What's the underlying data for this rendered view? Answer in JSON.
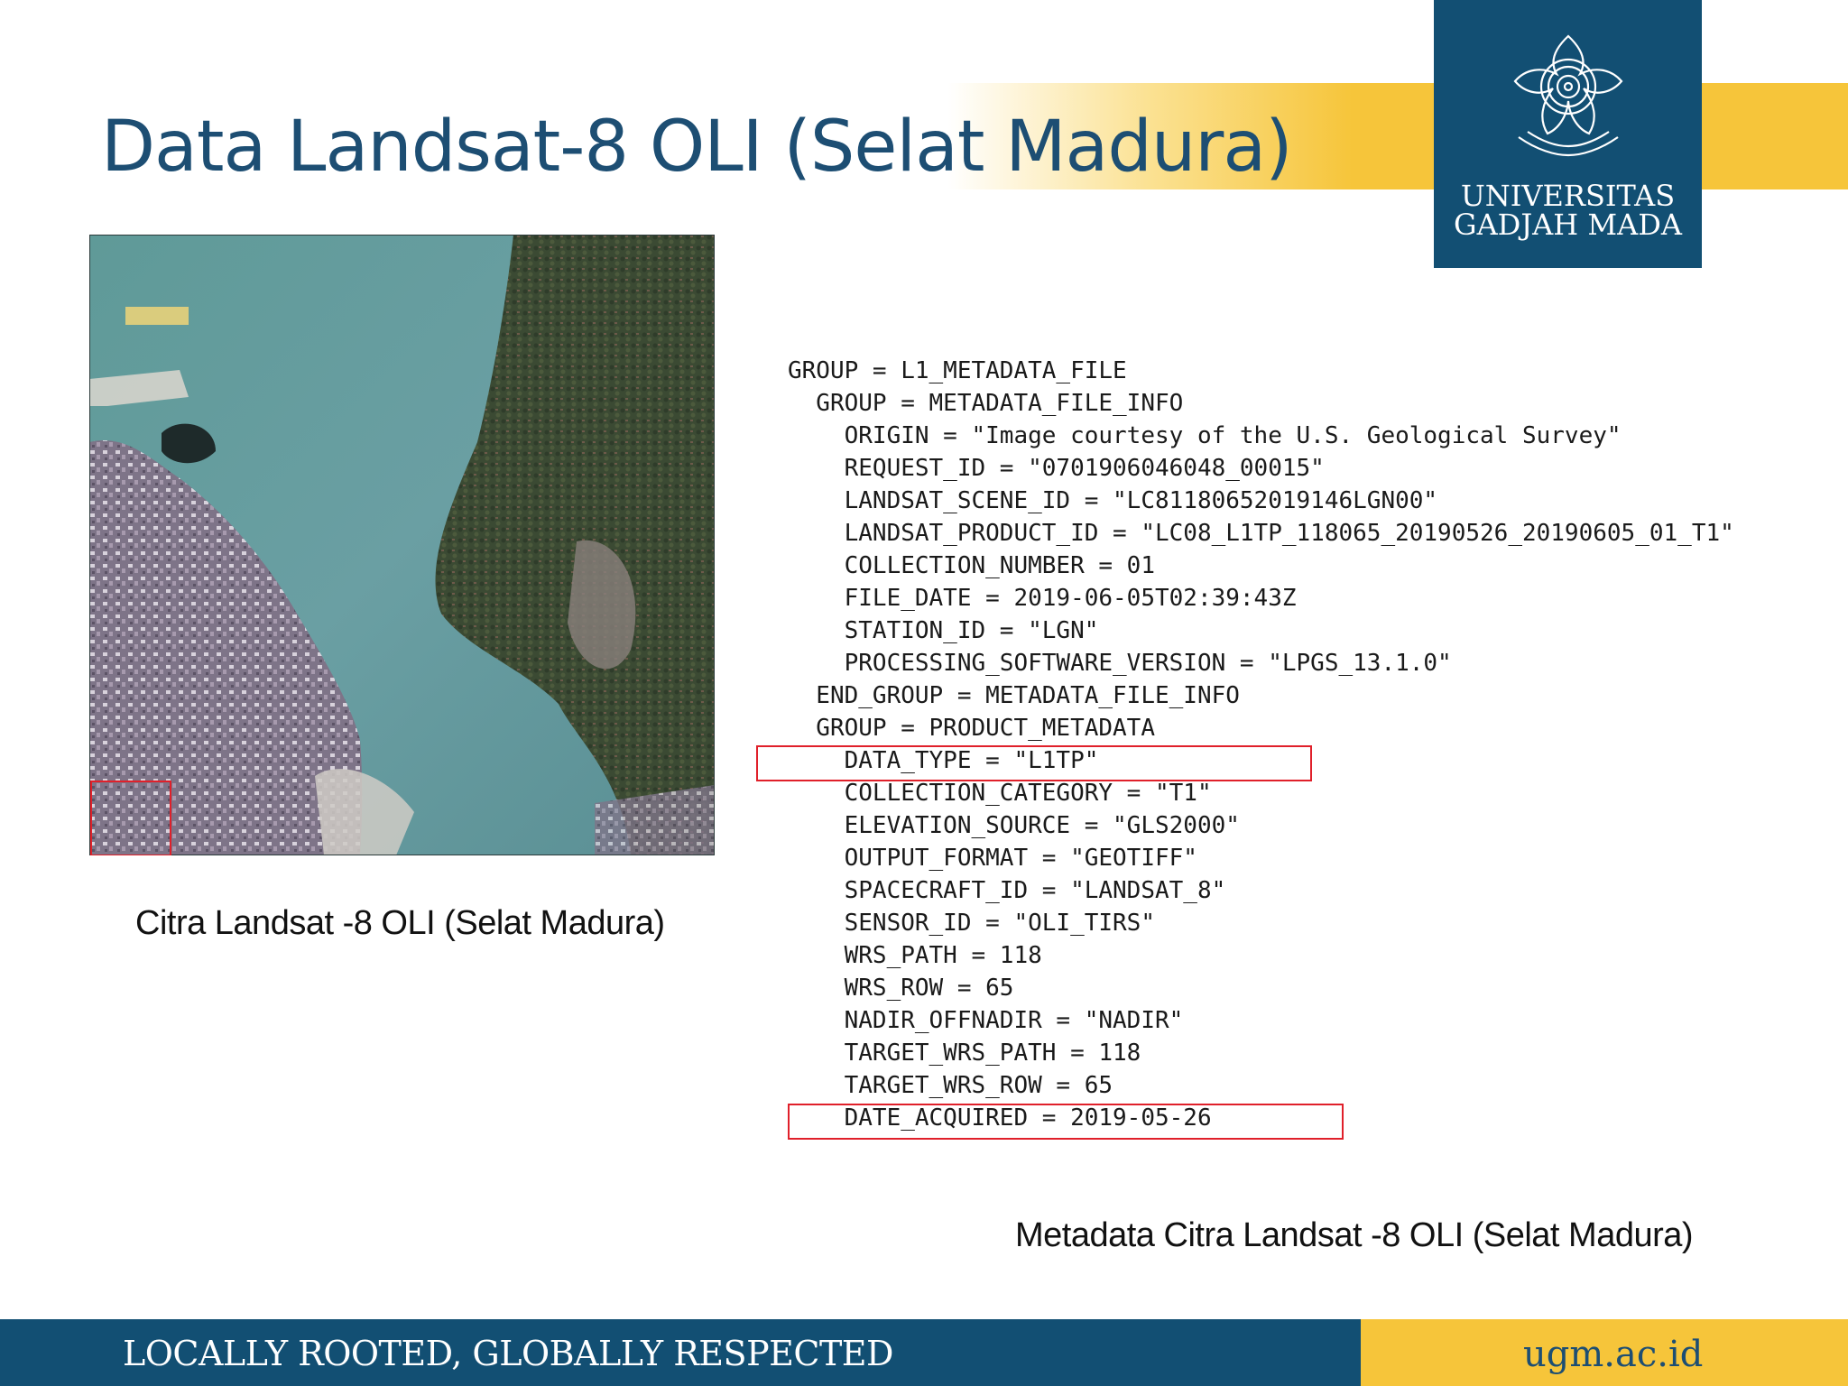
{
  "slide": {
    "title": "Data Landsat-8 OLI (Selat Madura)"
  },
  "logo": {
    "line1": "UNIVERSITAS",
    "line2": "GADJAH MADA",
    "emblem": "ugm-seal-icon"
  },
  "image": {
    "description_icon": "satellite-image",
    "caption": "Citra Landsat -8 OLI (Selat Madura)"
  },
  "metadata": {
    "lines": [
      "GROUP = L1_METADATA_FILE",
      "  GROUP = METADATA_FILE_INFO",
      "    ORIGIN = \"Image courtesy of the U.S. Geological Survey\"",
      "    REQUEST_ID = \"0701906046048_00015\"",
      "    LANDSAT_SCENE_ID = \"LC81180652019146LGN00\"",
      "    LANDSAT_PRODUCT_ID = \"LC08_L1TP_118065_20190526_20190605_01_T1\"",
      "    COLLECTION_NUMBER = 01",
      "    FILE_DATE = 2019-06-05T02:39:43Z",
      "    STATION_ID = \"LGN\"",
      "    PROCESSING_SOFTWARE_VERSION = \"LPGS_13.1.0\"",
      "  END_GROUP = METADATA_FILE_INFO",
      "  GROUP = PRODUCT_METADATA",
      "    DATA_TYPE = \"L1TP\"",
      "    COLLECTION_CATEGORY = \"T1\"",
      "    ELEVATION_SOURCE = \"GLS2000\"",
      "    OUTPUT_FORMAT = \"GEOTIFF\"",
      "    SPACECRAFT_ID = \"LANDSAT_8\"",
      "    SENSOR_ID = \"OLI_TIRS\"",
      "    WRS_PATH = 118",
      "    WRS_ROW = 65",
      "    NADIR_OFFNADIR = \"NADIR\"",
      "    TARGET_WRS_PATH = 118",
      "    TARGET_WRS_ROW = 65",
      "    DATE_ACQUIRED = 2019-05-26"
    ],
    "caption": "Metadata Citra Landsat -8 OLI (Selat Madura)",
    "highlight_color": "#e0202a"
  },
  "footer": {
    "motto": "LOCALLY ROOTED, GLOBALLY RESPECTED",
    "url": "ugm.ac.id"
  },
  "colors": {
    "brand_blue": "#124f73",
    "title_blue": "#1d4e73",
    "brand_gold": "#f6c53a"
  }
}
